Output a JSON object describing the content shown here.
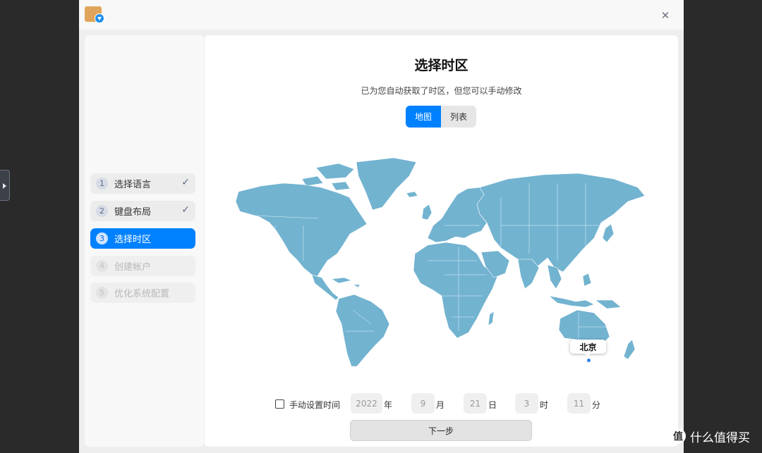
{
  "colors": {
    "accent": "#0081ff",
    "map_land": "#72b3d0",
    "background": "#2a2a2a",
    "window": "#eeeeee"
  },
  "titlebar": {
    "app_icon": "installer-package-icon",
    "close_icon": "close-icon"
  },
  "sidebar": {
    "steps": [
      {
        "number": "1",
        "label": "选择语言",
        "state": "done"
      },
      {
        "number": "2",
        "label": "键盘布局",
        "state": "done"
      },
      {
        "number": "3",
        "label": "选择时区",
        "state": "active"
      },
      {
        "number": "4",
        "label": "创建帐户",
        "state": "pending"
      },
      {
        "number": "5",
        "label": "优化系统配置",
        "state": "pending"
      }
    ]
  },
  "main": {
    "title": "选择时区",
    "subtitle": "已为您自动获取了时区，但您可以手动修改",
    "tabs": [
      {
        "label": "地图",
        "selected": true
      },
      {
        "label": "列表",
        "selected": false
      }
    ],
    "selected_city": "北京",
    "manual_time": {
      "label": "手动设置时间",
      "checked": false,
      "year": "2022",
      "year_unit": "年",
      "month": "9",
      "month_unit": "月",
      "day": "21",
      "day_unit": "日",
      "hour": "3",
      "hour_unit": "时",
      "minute": "11",
      "minute_unit": "分"
    },
    "next_button": "下一步"
  },
  "watermark": {
    "logo": "值",
    "text": "什么值得买"
  }
}
